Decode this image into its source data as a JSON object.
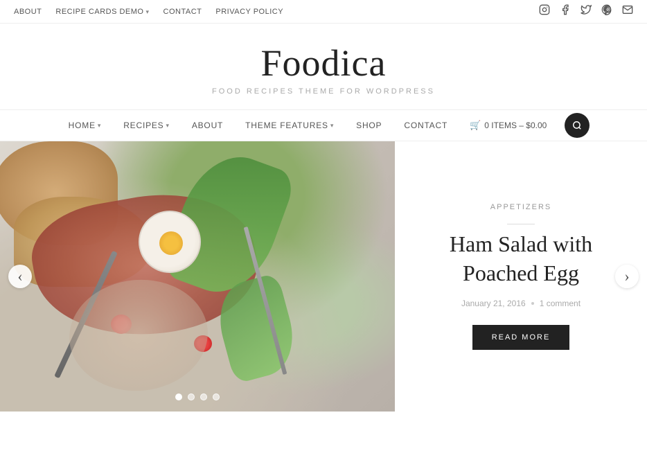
{
  "topNav": {
    "links": [
      {
        "id": "about",
        "label": "ABOUT",
        "hasDropdown": false
      },
      {
        "id": "recipe-cards-demo",
        "label": "RECIPE CARDS DEMO",
        "hasDropdown": true
      },
      {
        "id": "contact",
        "label": "CONTACT",
        "hasDropdown": false
      },
      {
        "id": "privacy-policy",
        "label": "PRIVACY POLICY",
        "hasDropdown": false
      }
    ],
    "icons": [
      {
        "id": "instagram",
        "symbol": "📷"
      },
      {
        "id": "facebook",
        "symbol": "f"
      },
      {
        "id": "twitter",
        "symbol": "𝕏"
      },
      {
        "id": "pinterest",
        "symbol": "𝐏"
      },
      {
        "id": "email",
        "symbol": "✉"
      }
    ]
  },
  "header": {
    "logo": "Foodica",
    "tagline": "FOOD RECIPES THEME FOR WORDPRESS"
  },
  "mainNav": {
    "items": [
      {
        "id": "home",
        "label": "HOME",
        "hasDropdown": true
      },
      {
        "id": "recipes",
        "label": "RECIPES",
        "hasDropdown": true
      },
      {
        "id": "about",
        "label": "ABOUT",
        "hasDropdown": false
      },
      {
        "id": "theme-features",
        "label": "THEME FEATURES",
        "hasDropdown": true
      },
      {
        "id": "shop",
        "label": "SHOP",
        "hasDropdown": false
      },
      {
        "id": "contact",
        "label": "CONTACT",
        "hasDropdown": false
      }
    ],
    "cart": {
      "label": "0 ITEMS – $0.00"
    }
  },
  "slider": {
    "category": "Appetizers",
    "title": "Ham Salad with Poached Egg",
    "date": "January 21, 2016",
    "comments": "1 comment",
    "readMoreLabel": "READ MORE",
    "dots": [
      {
        "id": "dot-1",
        "active": true
      },
      {
        "id": "dot-2",
        "active": false
      },
      {
        "id": "dot-3",
        "active": false
      },
      {
        "id": "dot-4",
        "active": false
      }
    ],
    "prevLabel": "‹",
    "nextLabel": "›"
  }
}
